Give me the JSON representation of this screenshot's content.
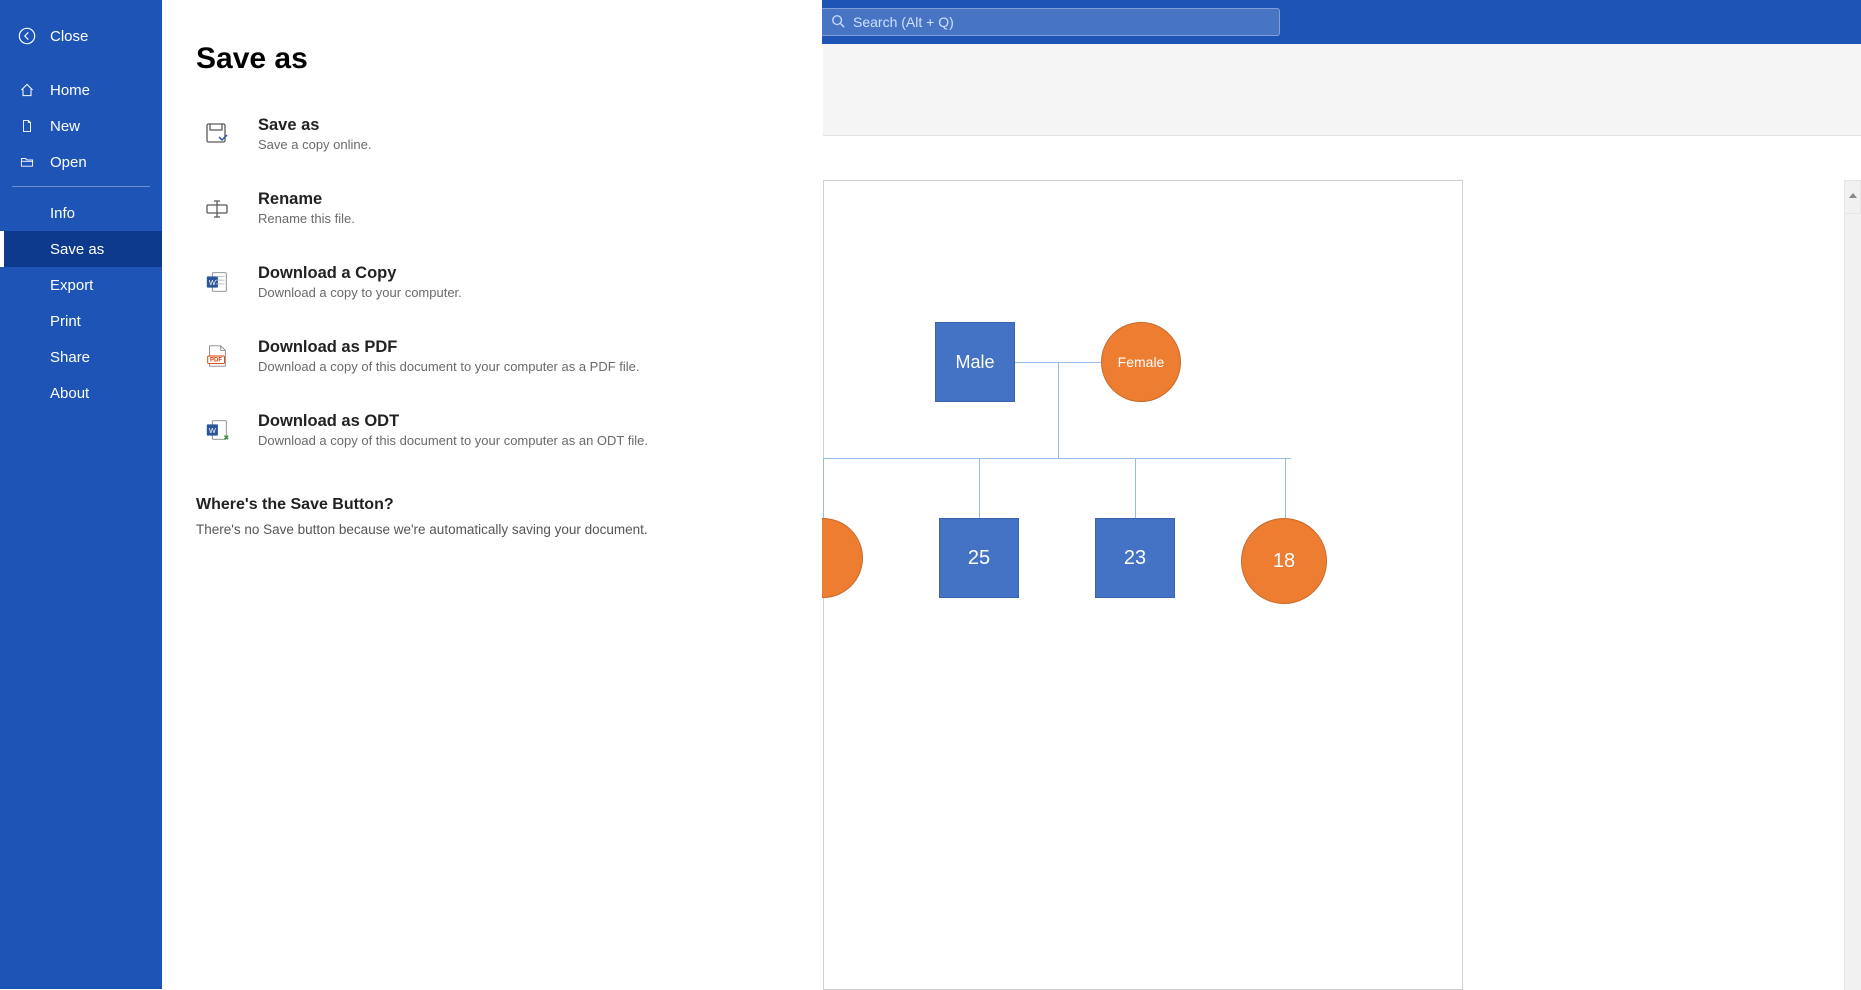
{
  "search_placeholder": "Search (Alt + Q)",
  "sidebar": {
    "close": "Close",
    "home": "Home",
    "new_": "New",
    "open": "Open",
    "info": "Info",
    "save_as": "Save as",
    "export": "Export",
    "print": "Print",
    "share": "Share",
    "about": "About"
  },
  "page": {
    "title": "Save as",
    "options": [
      {
        "title": "Save as",
        "sub": "Save a copy online."
      },
      {
        "title": "Rename",
        "sub": "Rename this file."
      },
      {
        "title": "Download a Copy",
        "sub": "Download a copy to your computer."
      },
      {
        "title": "Download as PDF",
        "sub": "Download a copy of this document to your computer as a PDF file."
      },
      {
        "title": "Download as ODT",
        "sub": "Download a copy of this document to your computer as an ODT file."
      }
    ],
    "note_title": "Where's the Save Button?",
    "note_body": "There's no Save button because we're automatically saving your document."
  },
  "chart_data": {
    "type": "tree",
    "nodes": [
      {
        "id": "male",
        "label": "Male",
        "shape": "square",
        "color": "#4472c4",
        "row": 0
      },
      {
        "id": "female",
        "label": "Female",
        "shape": "circle",
        "color": "#ed7d31",
        "row": 0
      },
      {
        "id": "c1",
        "label": "",
        "shape": "circle",
        "color": "#ed7d31",
        "row": 1
      },
      {
        "id": "c2",
        "label": "25",
        "shape": "square",
        "color": "#4472c4",
        "row": 1
      },
      {
        "id": "c3",
        "label": "23",
        "shape": "square",
        "color": "#4472c4",
        "row": 1
      },
      {
        "id": "c4",
        "label": "18",
        "shape": "circle",
        "color": "#ed7d31",
        "row": 1
      }
    ],
    "edges_from_parents_to": [
      "c1",
      "c2",
      "c3",
      "c4"
    ],
    "couple": [
      "male",
      "female"
    ]
  }
}
